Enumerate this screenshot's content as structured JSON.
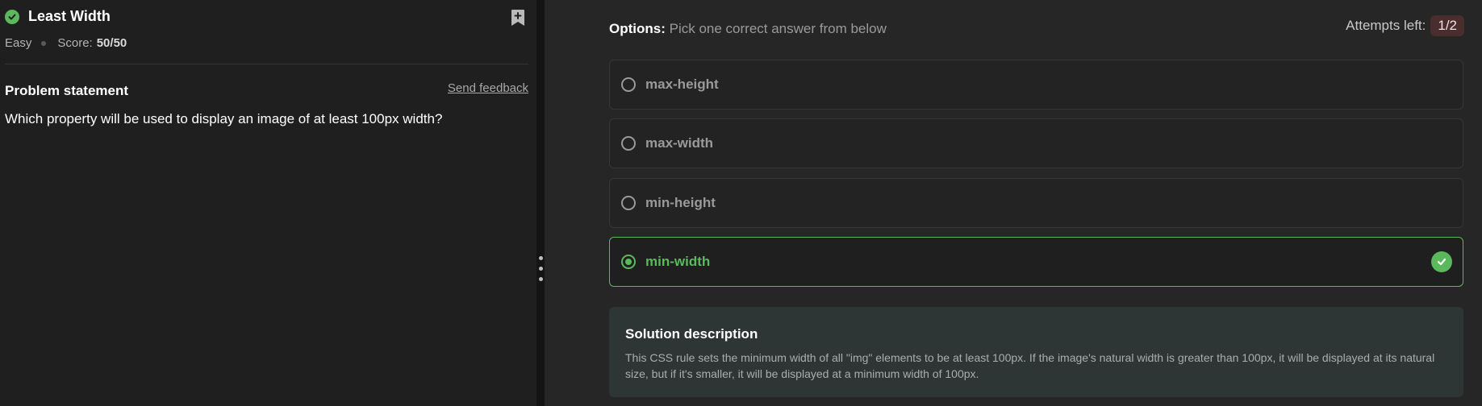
{
  "problem": {
    "title": "Least Width",
    "difficulty": "Easy",
    "score_label": "Score:",
    "score_value": "50/50",
    "statement_title": "Problem statement",
    "feedback_link": "Send feedback",
    "question": "Which property will be used to display an image of at least 100px width?"
  },
  "options_panel": {
    "heading_bold": "Options:",
    "heading_rest": " Pick one correct answer from below",
    "attempts_label": "Attempts left:",
    "attempts_value": "1/2",
    "options": [
      {
        "label": "max-height",
        "state": "unselected"
      },
      {
        "label": "max-width",
        "state": "unselected"
      },
      {
        "label": "min-height",
        "state": "unselected"
      },
      {
        "label": "min-width",
        "state": "selected-correct"
      }
    ]
  },
  "solution": {
    "title": "Solution description",
    "text": "This CSS rule sets the minimum width of all \"img\" elements to be at least 100px. If the image's natural width is greater than 100px, it will be displayed at its natural size, but if it's smaller, it will be displayed at a minimum width of 100px."
  },
  "icons": {
    "solved": "check-circle-icon",
    "bookmark": "bookmark-add-icon",
    "correct": "check-circle-icon",
    "splitter": "drag-handle-icon"
  },
  "colors": {
    "accent_green": "#5cb85c",
    "attempts_badge": "#4a2e2e"
  }
}
